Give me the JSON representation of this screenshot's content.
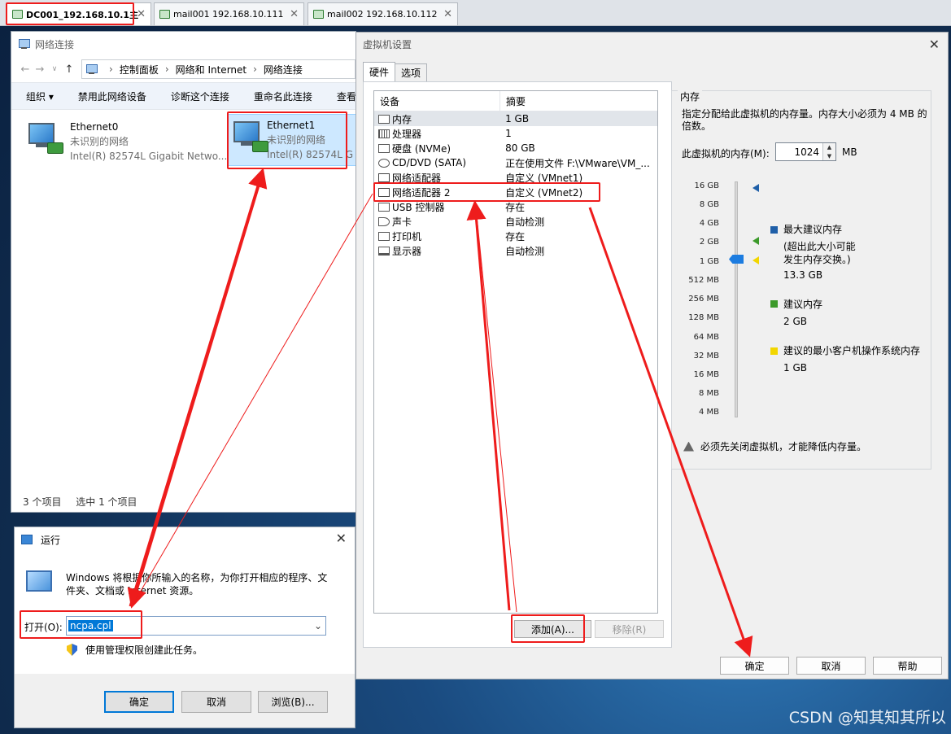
{
  "vm_tabs": [
    {
      "label": "DC001_192.168.10.1主"
    },
    {
      "label": "mail001 192.168.10.111"
    },
    {
      "label": "mail002 192.168.10.112"
    }
  ],
  "network_window": {
    "title": "网络连接",
    "breadcrumb": [
      "控制面板",
      "网络和 Internet",
      "网络连接"
    ],
    "commands": [
      "组织 ▾",
      "禁用此网络设备",
      "诊断这个连接",
      "重命名此连接",
      "查看"
    ],
    "adapters": [
      {
        "name": "Ethernet0",
        "status": "未识别的网络",
        "device": "Intel(R) 82574L Gigabit Netwo..."
      },
      {
        "name": "Ethernet1",
        "status": "未识别的网络",
        "device": "Intel(R) 82574L G"
      }
    ],
    "status_count": "3 个项目",
    "status_selected": "选中 1 个项目"
  },
  "run_dialog": {
    "title": "运行",
    "description": "Windows 将根据你所输入的名称，为你打开相应的程序、文件夹、文档或 Internet 资源。",
    "open_label": "打开(O):",
    "open_value": "ncpa.cpl",
    "admin_text": "使用管理权限创建此任务。",
    "ok": "确定",
    "cancel": "取消",
    "browse": "浏览(B)..."
  },
  "vm_settings": {
    "title": "虚拟机设置",
    "tabs": [
      "硬件",
      "选项"
    ],
    "columns": {
      "device": "设备",
      "summary": "摘要"
    },
    "devices": [
      {
        "icon": "memory-icon",
        "name": "内存",
        "summary": "1 GB"
      },
      {
        "icon": "cpu-icon",
        "name": "处理器",
        "summary": "1"
      },
      {
        "icon": "disk-icon",
        "name": "硬盘 (NVMe)",
        "summary": "80 GB"
      },
      {
        "icon": "cdrom-icon",
        "name": "CD/DVD (SATA)",
        "summary": "正在使用文件 F:\\VMware\\VM_..."
      },
      {
        "icon": "network-icon",
        "name": "网络适配器",
        "summary": "自定义 (VMnet1)"
      },
      {
        "icon": "network-icon",
        "name": "网络适配器 2",
        "summary": "自定义 (VMnet2)"
      },
      {
        "icon": "usb-icon",
        "name": "USB 控制器",
        "summary": "存在"
      },
      {
        "icon": "sound-icon",
        "name": "声卡",
        "summary": "自动检测"
      },
      {
        "icon": "printer-icon",
        "name": "打印机",
        "summary": "存在"
      },
      {
        "icon": "display-icon",
        "name": "显示器",
        "summary": "自动检测"
      }
    ],
    "add_button": "添加(A)...",
    "remove_button": "移除(R)",
    "memory": {
      "section_title": "内存",
      "description": "指定分配给此虚拟机的内存量。内存大小必须为 4 MB 的倍数。",
      "field_label": "此虚拟机的内存(M):",
      "value": "1024",
      "unit": "MB",
      "scale": [
        "16 GB",
        "8 GB",
        "4 GB",
        "2 GB",
        "1 GB",
        "512 MB",
        "256 MB",
        "128 MB",
        "64 MB",
        "32 MB",
        "16 MB",
        "8 MB",
        "4 MB"
      ],
      "legend": [
        {
          "color": "#1f5fa8",
          "label": "最大建议内存",
          "note": "(超出此大小可能发生内存交换。)",
          "value": "13.3 GB"
        },
        {
          "color": "#3c9a2a",
          "label": "建议内存",
          "value": "2 GB"
        },
        {
          "color": "#f2d600",
          "label": "建议的最小客户机操作系统内存",
          "value": "1 GB"
        }
      ],
      "warning": "必须先关闭虚拟机，才能降低内存量。"
    },
    "ok": "确定",
    "cancel": "取消",
    "help": "帮助"
  },
  "watermark": "CSDN @知其知其所以",
  "colors": {
    "annotation_red": "#ee1c1c",
    "selection_blue": "#0078d7"
  }
}
